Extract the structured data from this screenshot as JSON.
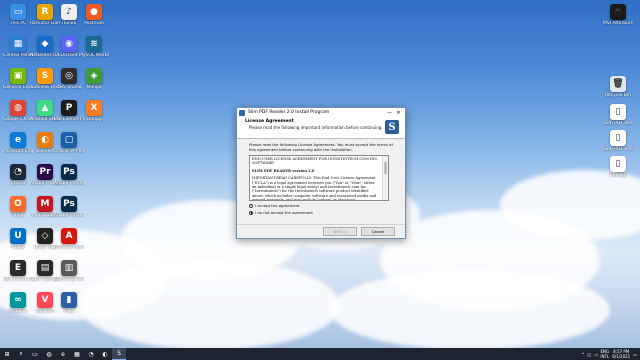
{
  "desktop_icons": [
    {
      "label": "This PC",
      "color": "#3a8ee6",
      "glyph": "▭"
    },
    {
      "label": "Rockstar Games",
      "color": "#e8a400",
      "glyph": "R"
    },
    {
      "label": "iTunes",
      "color": "#f0f0f0",
      "glyph": "♪"
    },
    {
      "label": "Postman",
      "color": "#ef5b25",
      "glyph": "●"
    },
    {
      "label": "Control Panel",
      "color": "#2d7dd2",
      "glyph": "▦"
    },
    {
      "label": "NetBeans IDE 8.2",
      "color": "#1b6ac9",
      "glyph": "◆"
    },
    {
      "label": "Discord",
      "color": "#5865f2",
      "glyph": "◉"
    },
    {
      "label": "MySQL Workbench",
      "color": "#1a6b93",
      "glyph": "≋"
    },
    {
      "label": "GeForce Experience",
      "color": "#76b900",
      "glyph": "▣"
    },
    {
      "label": "Sublime Text",
      "color": "#ff9800",
      "glyph": "S"
    },
    {
      "label": "OBS Studio",
      "color": "#302e31",
      "glyph": "◎"
    },
    {
      "label": "Mongo",
      "color": "#3f9c35",
      "glyph": "◈"
    },
    {
      "label": "Google Chrome",
      "color": "#db4437",
      "glyph": "◍"
    },
    {
      "label": "Android Studio",
      "color": "#3ddc84",
      "glyph": "▲"
    },
    {
      "label": "PDFElement Pro",
      "color": "#1c1c1c",
      "glyph": "P"
    },
    {
      "label": "xampp",
      "color": "#fb7a24",
      "glyph": "X"
    },
    {
      "label": "Microsoft Edge",
      "color": "#0c7bd8",
      "glyph": "e"
    },
    {
      "label": "Blender",
      "color": "#e87d0d",
      "glyph": "◐"
    },
    {
      "label": "Oracle VM VirtualBox",
      "color": "#1a5fa8",
      "glyph": "▢"
    },
    {
      "label": "Steam",
      "color": "#1b2838",
      "glyph": "◔"
    },
    {
      "label": "Adobe Premiere",
      "color": "#2a0a4a",
      "glyph": "Pr"
    },
    {
      "label": "Adobe Photoshop",
      "color": "#0b2b4a",
      "glyph": "Ps"
    },
    {
      "label": "Origin",
      "color": "#f56c2d",
      "glyph": "O"
    },
    {
      "label": "MSI Dragon",
      "color": "#c4161c",
      "glyph": "M"
    },
    {
      "label": "Adobe Photoshop",
      "color": "#0b2b4a",
      "glyph": "Ps"
    },
    {
      "label": "Uplay",
      "color": "#0070c9",
      "glyph": "U"
    },
    {
      "label": "Unity Hub",
      "color": "#222",
      "glyph": "◇"
    },
    {
      "label": "Acrobat Reader DC",
      "color": "#d4190c",
      "glyph": "A"
    },
    {
      "label": "Epic Games Launcher",
      "color": "#2a2a2a",
      "glyph": "E"
    },
    {
      "label": "Epic Games",
      "color": "#2a2a2a",
      "glyph": "▤"
    },
    {
      "label": "Samsung Galaxy",
      "color": "#5a5a5a",
      "glyph": "▥"
    },
    {
      "label": "Arduino",
      "color": "#00979d",
      "glyph": "∞"
    },
    {
      "label": "Valorant",
      "color": "#ff4655",
      "glyph": "V"
    },
    {
      "label": "Files",
      "color": "#2d5fa8",
      "glyph": "▮"
    }
  ],
  "right_icons": [
    {
      "label": "MSI Afterburner",
      "color": "#1a1a1a",
      "glyph": "◓"
    },
    {
      "label": "Recycle Bin",
      "color": "#dfe7ef",
      "glyph": "🗑"
    },
    {
      "label": "Slim PDF Reader",
      "color": "#ffffff",
      "glyph": "▯"
    },
    {
      "label": "Slim PDF Reader",
      "color": "#ffffff",
      "glyph": "▯"
    },
    {
      "label": "Startup",
      "color": "#ffffff",
      "glyph": "▯"
    }
  ],
  "installer": {
    "title": "Slim PDF Reader 2.0 Install Program",
    "minimize": "—",
    "close": "✕",
    "heading": "License Agreement",
    "subheading": "Please read the following important information before continuing.",
    "logo": "S",
    "instructions": "Please read the following License Agreement. You must accept the terms of this agreement before continuing with the installation.",
    "license_paragraphs": [
      "END-USER LICENSE AGREEMENT FOR INVESTINTECH.COM INC. SOFTWARE:",
      "SLIM PDF READER version 2.0",
      "IMPORTANT-READ CAREFULLY: This End-User License Agreement (\"EULA\") is a legal agreement between you (\"You\" or \"Your\", either an individual or a single legal entity) and Investintech.com Inc. (\"Investintech\") for the Investintech software product identified above, which includes computer software and associated media and printed materials, and may include \"online\" or electronic documentation"
    ],
    "accept_label": "I accept the agreement",
    "decline_label": "I do not accept the agreement",
    "next_label": "Next >",
    "cancel_label": "Cancel"
  },
  "taskbar": {
    "start": "⊞",
    "search": "⌕",
    "items": [
      "▭",
      "◍",
      "e",
      "▦",
      "◔",
      "◐",
      "S"
    ],
    "lang_top": "ENG",
    "lang_bottom": "INTL",
    "time": "8:57 PM",
    "date": "6/1/2021"
  }
}
